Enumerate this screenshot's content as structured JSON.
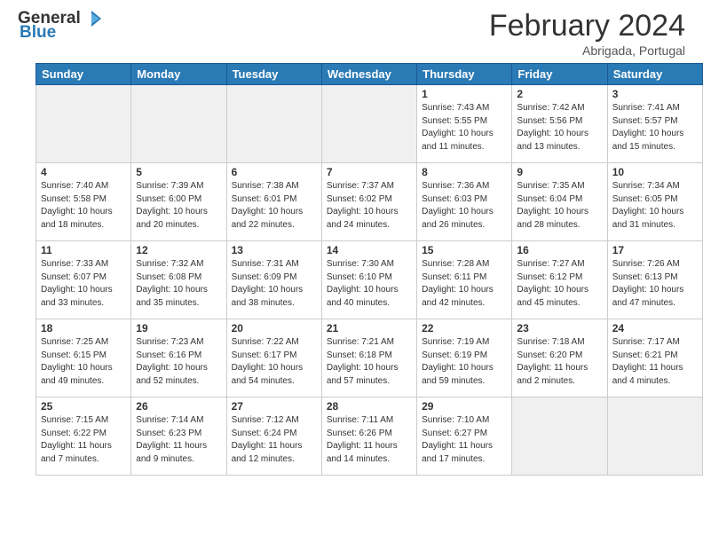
{
  "header": {
    "logo": {
      "general": "General",
      "blue": "Blue"
    },
    "title": "February 2024",
    "location": "Abrigada, Portugal"
  },
  "days_of_week": [
    "Sunday",
    "Monday",
    "Tuesday",
    "Wednesday",
    "Thursday",
    "Friday",
    "Saturday"
  ],
  "weeks": [
    [
      {
        "day": "",
        "info": "",
        "empty": true
      },
      {
        "day": "",
        "info": "",
        "empty": true
      },
      {
        "day": "",
        "info": "",
        "empty": true
      },
      {
        "day": "",
        "info": "",
        "empty": true
      },
      {
        "day": "1",
        "info": "Sunrise: 7:43 AM\nSunset: 5:55 PM\nDaylight: 10 hours and 11 minutes."
      },
      {
        "day": "2",
        "info": "Sunrise: 7:42 AM\nSunset: 5:56 PM\nDaylight: 10 hours and 13 minutes."
      },
      {
        "day": "3",
        "info": "Sunrise: 7:41 AM\nSunset: 5:57 PM\nDaylight: 10 hours and 15 minutes."
      }
    ],
    [
      {
        "day": "4",
        "info": "Sunrise: 7:40 AM\nSunset: 5:58 PM\nDaylight: 10 hours and 18 minutes."
      },
      {
        "day": "5",
        "info": "Sunrise: 7:39 AM\nSunset: 6:00 PM\nDaylight: 10 hours and 20 minutes."
      },
      {
        "day": "6",
        "info": "Sunrise: 7:38 AM\nSunset: 6:01 PM\nDaylight: 10 hours and 22 minutes."
      },
      {
        "day": "7",
        "info": "Sunrise: 7:37 AM\nSunset: 6:02 PM\nDaylight: 10 hours and 24 minutes."
      },
      {
        "day": "8",
        "info": "Sunrise: 7:36 AM\nSunset: 6:03 PM\nDaylight: 10 hours and 26 minutes."
      },
      {
        "day": "9",
        "info": "Sunrise: 7:35 AM\nSunset: 6:04 PM\nDaylight: 10 hours and 28 minutes."
      },
      {
        "day": "10",
        "info": "Sunrise: 7:34 AM\nSunset: 6:05 PM\nDaylight: 10 hours and 31 minutes."
      }
    ],
    [
      {
        "day": "11",
        "info": "Sunrise: 7:33 AM\nSunset: 6:07 PM\nDaylight: 10 hours and 33 minutes."
      },
      {
        "day": "12",
        "info": "Sunrise: 7:32 AM\nSunset: 6:08 PM\nDaylight: 10 hours and 35 minutes."
      },
      {
        "day": "13",
        "info": "Sunrise: 7:31 AM\nSunset: 6:09 PM\nDaylight: 10 hours and 38 minutes."
      },
      {
        "day": "14",
        "info": "Sunrise: 7:30 AM\nSunset: 6:10 PM\nDaylight: 10 hours and 40 minutes."
      },
      {
        "day": "15",
        "info": "Sunrise: 7:28 AM\nSunset: 6:11 PM\nDaylight: 10 hours and 42 minutes."
      },
      {
        "day": "16",
        "info": "Sunrise: 7:27 AM\nSunset: 6:12 PM\nDaylight: 10 hours and 45 minutes."
      },
      {
        "day": "17",
        "info": "Sunrise: 7:26 AM\nSunset: 6:13 PM\nDaylight: 10 hours and 47 minutes."
      }
    ],
    [
      {
        "day": "18",
        "info": "Sunrise: 7:25 AM\nSunset: 6:15 PM\nDaylight: 10 hours and 49 minutes."
      },
      {
        "day": "19",
        "info": "Sunrise: 7:23 AM\nSunset: 6:16 PM\nDaylight: 10 hours and 52 minutes."
      },
      {
        "day": "20",
        "info": "Sunrise: 7:22 AM\nSunset: 6:17 PM\nDaylight: 10 hours and 54 minutes."
      },
      {
        "day": "21",
        "info": "Sunrise: 7:21 AM\nSunset: 6:18 PM\nDaylight: 10 hours and 57 minutes."
      },
      {
        "day": "22",
        "info": "Sunrise: 7:19 AM\nSunset: 6:19 PM\nDaylight: 10 hours and 59 minutes."
      },
      {
        "day": "23",
        "info": "Sunrise: 7:18 AM\nSunset: 6:20 PM\nDaylight: 11 hours and 2 minutes."
      },
      {
        "day": "24",
        "info": "Sunrise: 7:17 AM\nSunset: 6:21 PM\nDaylight: 11 hours and 4 minutes."
      }
    ],
    [
      {
        "day": "25",
        "info": "Sunrise: 7:15 AM\nSunset: 6:22 PM\nDaylight: 11 hours and 7 minutes."
      },
      {
        "day": "26",
        "info": "Sunrise: 7:14 AM\nSunset: 6:23 PM\nDaylight: 11 hours and 9 minutes."
      },
      {
        "day": "27",
        "info": "Sunrise: 7:12 AM\nSunset: 6:24 PM\nDaylight: 11 hours and 12 minutes."
      },
      {
        "day": "28",
        "info": "Sunrise: 7:11 AM\nSunset: 6:26 PM\nDaylight: 11 hours and 14 minutes."
      },
      {
        "day": "29",
        "info": "Sunrise: 7:10 AM\nSunset: 6:27 PM\nDaylight: 11 hours and 17 minutes."
      },
      {
        "day": "",
        "info": "",
        "empty": true
      },
      {
        "day": "",
        "info": "",
        "empty": true
      }
    ]
  ]
}
